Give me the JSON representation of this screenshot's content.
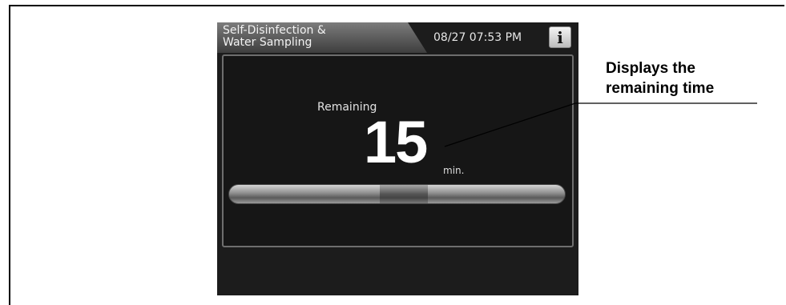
{
  "screen": {
    "title_tab": "Self-Disinfection &\nWater Sampling",
    "datetime": "08/27 07:53 PM",
    "info_button_label": "i",
    "remaining_label": "Remaining",
    "remaining_value": "15",
    "remaining_unit": "min.",
    "progress_fraction": 0.52
  },
  "annotation": {
    "callout_text": "Displays the\nremaining time"
  },
  "colors": {
    "screen_bg": "#1c1c1c",
    "text_primary": "#ffffff"
  }
}
